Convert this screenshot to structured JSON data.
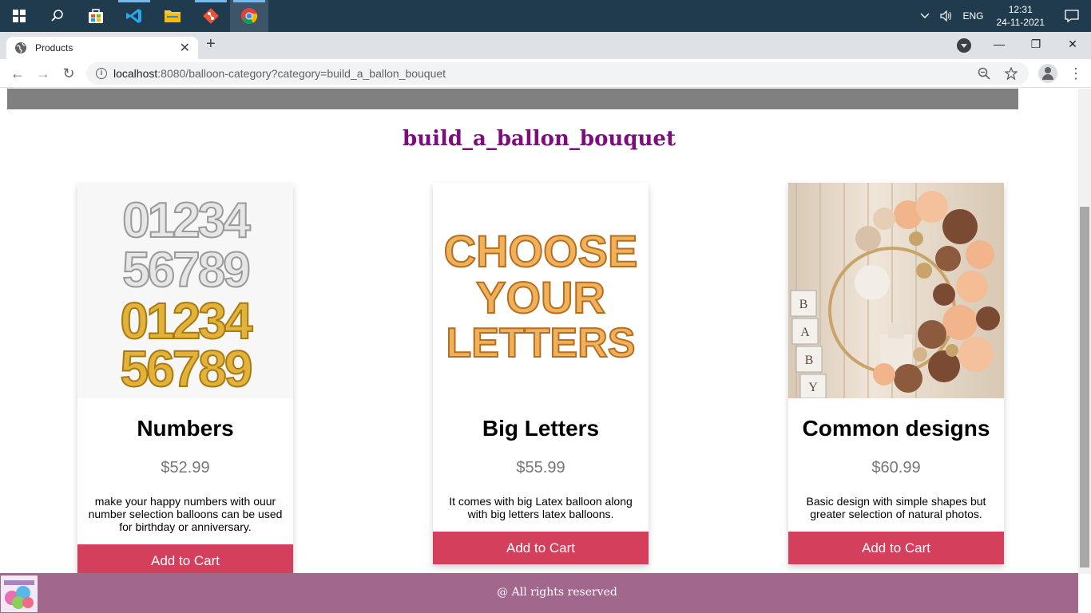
{
  "taskbar": {
    "language": "ENG",
    "time": "12:31",
    "date": "24-11-2021"
  },
  "browser": {
    "tab_title": "Products",
    "url_host": "localhost",
    "url_path": ":8080/balloon-category?category=build_a_ballon_bouquet"
  },
  "page": {
    "category_title": "build_a_ballon_bouquet",
    "products": [
      {
        "name": "Numbers",
        "price": "$52.99",
        "description": "make your happy numbers with ouur number selection balloons can be used for birthday or anniversary.",
        "button": "Add to Cart"
      },
      {
        "name": "Big Letters",
        "price": "$55.99",
        "description": "It comes with big Latex balloon along with big letters latex balloons.",
        "button": "Add to Cart"
      },
      {
        "name": "Common designs",
        "price": "$60.99",
        "description": "Basic design with simple shapes but greater selection of natural photos.",
        "button": "Add to Cart"
      }
    ],
    "footer_text": "@ All rights reserved"
  },
  "image_text": {
    "numbers_row1": "01234",
    "numbers_row2": "56789",
    "letters_row1": "CHOOSE",
    "letters_row2": "YOUR",
    "letters_row3": "LETTERS",
    "blocks": [
      "B",
      "A",
      "B",
      "Y"
    ]
  },
  "colors": {
    "heading": "#7b0e7b",
    "button": "#d43f5c",
    "footer": "#a2678c",
    "band": "#808080"
  }
}
